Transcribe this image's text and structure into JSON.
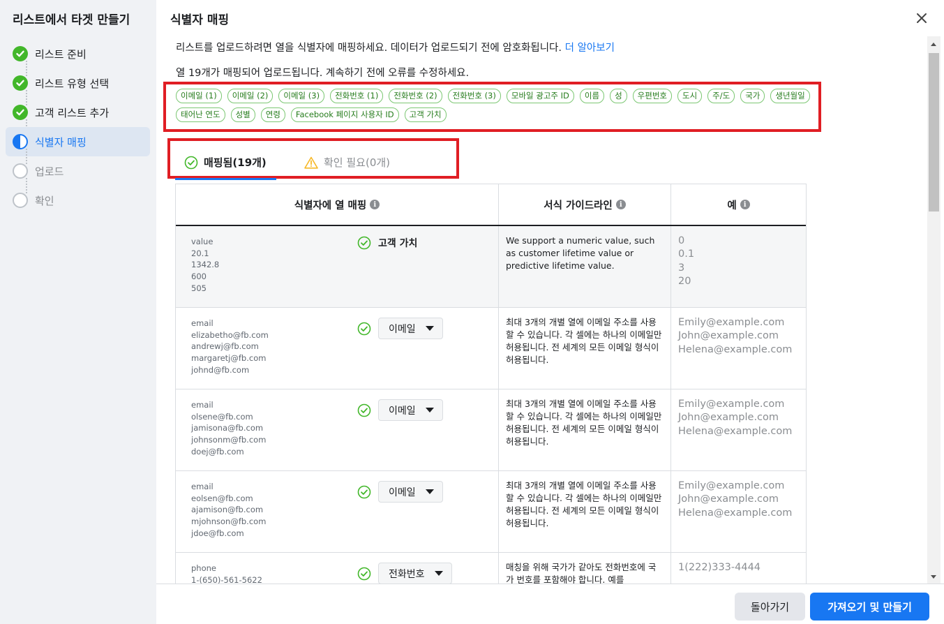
{
  "sidebar": {
    "title": "리스트에서 타겟 만들기",
    "steps": [
      {
        "label": "리스트 준비",
        "state": "done"
      },
      {
        "label": "리스트 유형 선택",
        "state": "done"
      },
      {
        "label": "고객 리스트 추가",
        "state": "done"
      },
      {
        "label": "식별자 매핑",
        "state": "active"
      },
      {
        "label": "업로드",
        "state": "pending"
      },
      {
        "label": "확인",
        "state": "pending"
      }
    ]
  },
  "dialog": {
    "title": "식별자 매핑",
    "description": "리스트를 업로드하려면 열을 식별자에 매핑하세요. 데이터가 업로드되기 전에 암호화됩니다.",
    "learn_more": "더 알아보기",
    "count_line": "열 19개가 매핑되어 업로드됩니다. 계속하기 전에 오류를 수정하세요."
  },
  "chips": [
    "이메일 (1)",
    "이메일 (2)",
    "이메일 (3)",
    "전화번호 (1)",
    "전화번호 (2)",
    "전화번호 (3)",
    "모바일 광고주 ID",
    "이름",
    "성",
    "우편번호",
    "도시",
    "주/도",
    "국가",
    "생년월일",
    "태어난 연도",
    "성별",
    "연령",
    "Facebook 페이지 사용자 ID",
    "고객 가치"
  ],
  "tabs": {
    "mapped": "매핑됨(19개)",
    "needs_review": "확인 필요(0개)"
  },
  "table": {
    "headers": {
      "mapping": "식별자에 열 매핑",
      "guideline": "서식 가이드라인",
      "example": "예"
    },
    "rows": [
      {
        "samples": "value\n20.1\n1342.8\n600\n505",
        "identifier": "고객 가치",
        "dropdown": false,
        "guideline": "We support a numeric value, such as customer lifetime value or predictive lifetime value.",
        "example": "0\n0.1\n3\n20"
      },
      {
        "samples": "email\nelizabetho@fb.com\nandrewj@fb.com\nmargaretj@fb.com\njohnd@fb.com",
        "identifier": "이메일",
        "dropdown": true,
        "guideline": "최대 3개의 개별 열에 이메일 주소를 사용할 수 있습니다. 각 셀에는 하나의 이메일만 허용됩니다. 전 세계의 모든 이메일 형식이 허용됩니다.",
        "example": "Emily@example.com\nJohn@example.com\nHelena@example.com"
      },
      {
        "samples": "email\nolsene@fb.com\njamisona@fb.com\njohnsonm@fb.com\ndoej@fb.com",
        "identifier": "이메일",
        "dropdown": true,
        "guideline": "최대 3개의 개별 열에 이메일 주소를 사용할 수 있습니다. 각 셀에는 하나의 이메일만 허용됩니다. 전 세계의 모든 이메일 형식이 허용됩니다.",
        "example": "Emily@example.com\nJohn@example.com\nHelena@example.com"
      },
      {
        "samples": "email\neolsen@fb.com\najamison@fb.com\nmjohnson@fb.com\njdoe@fb.com",
        "identifier": "이메일",
        "dropdown": true,
        "guideline": "최대 3개의 개별 열에 이메일 주소를 사용할 수 있습니다. 각 셀에는 하나의 이메일만 허용됩니다. 전 세계의 모든 이메일 형식이 허용됩니다.",
        "example": "Emily@example.com\nJohn@example.com\nHelena@example.com"
      },
      {
        "samples": "phone\n1-(650)-561-5622",
        "identifier": "전화번호",
        "dropdown": true,
        "guideline": "매칭을 위해 국가가 같아도 전화번호에 국가 번호를 포함해야 합니다. 예를",
        "example": "1(222)333-4444"
      }
    ]
  },
  "footer": {
    "back": "돌아가기",
    "import_create": "가져오기 및 만들기"
  },
  "icons": {
    "close": "close-icon",
    "check": "check-circle-icon",
    "warning": "warning-triangle-icon",
    "info": "info-icon"
  },
  "colors": {
    "accent": "#1877f2",
    "success": "#42b72a",
    "highlight_box": "#e01e24",
    "warning": "#f7b928"
  }
}
